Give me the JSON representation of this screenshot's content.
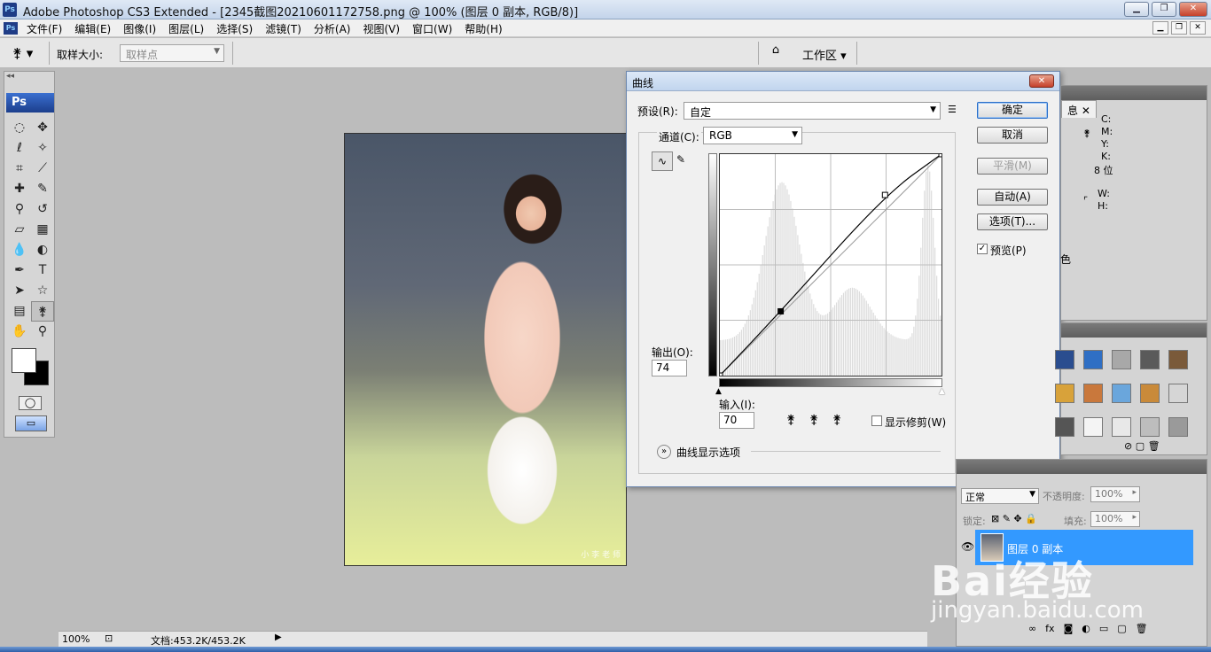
{
  "window": {
    "title": "Adobe Photoshop CS3 Extended - [2345截图20210601172758.png @ 100% (图层 0 副本, RGB/8)]",
    "app_icon_label": "Ps",
    "buttons": [
      "▁",
      "❐",
      "✕"
    ]
  },
  "menubar": {
    "items": [
      "文件(F)",
      "编辑(E)",
      "图像(I)",
      "图层(L)",
      "选择(S)",
      "滤镜(T)",
      "分析(A)",
      "视图(V)",
      "窗口(W)",
      "帮助(H)"
    ],
    "doc_buttons": [
      "▁",
      "❐",
      "✕"
    ]
  },
  "options": {
    "tool_icon": "eyedropper-icon",
    "sample_size_label": "取样大小:",
    "sample_size_value": "取样点",
    "workspace_label": "工作区 ▾"
  },
  "toolbox": {
    "logo": "Ps",
    "tools": [
      {
        "name": "marquee-icon",
        "glyph": "◌"
      },
      {
        "name": "move-icon",
        "glyph": "✥"
      },
      {
        "name": "lasso-icon",
        "glyph": "ℓ"
      },
      {
        "name": "magic-wand-icon",
        "glyph": "✧"
      },
      {
        "name": "crop-icon",
        "glyph": "⌗"
      },
      {
        "name": "slice-icon",
        "glyph": "⟋"
      },
      {
        "name": "healing-brush-icon",
        "glyph": "✚"
      },
      {
        "name": "brush-icon",
        "glyph": "✎"
      },
      {
        "name": "clone-stamp-icon",
        "glyph": "⚲"
      },
      {
        "name": "history-brush-icon",
        "glyph": "↺"
      },
      {
        "name": "eraser-icon",
        "glyph": "▱"
      },
      {
        "name": "gradient-icon",
        "glyph": "▦"
      },
      {
        "name": "blur-icon",
        "glyph": "💧"
      },
      {
        "name": "dodge-icon",
        "glyph": "◐"
      },
      {
        "name": "pen-icon",
        "glyph": "✒"
      },
      {
        "name": "type-icon",
        "glyph": "T"
      },
      {
        "name": "path-selection-icon",
        "glyph": "➤"
      },
      {
        "name": "shape-icon",
        "glyph": "☆"
      },
      {
        "name": "notes-icon",
        "glyph": "▤"
      },
      {
        "name": "eyedropper-tool-icon",
        "glyph": "⚵"
      },
      {
        "name": "hand-icon",
        "glyph": "✋"
      },
      {
        "name": "zoom-icon",
        "glyph": "⚲"
      }
    ],
    "active_tool": "eyedropper-tool-icon"
  },
  "canvas": {
    "watermark": "小 李 老 师"
  },
  "status": {
    "zoom": "100%",
    "doc_size": "文档:453.2K/453.2K"
  },
  "curves": {
    "title": "曲线",
    "preset_label": "预设(R):",
    "preset_value": "自定",
    "channel_label": "通道(C):",
    "channel_value": "RGB",
    "output_label": "输出(O):",
    "output_value": "74",
    "input_label": "输入(I):",
    "input_value": "70",
    "show_clipping_label": "显示修剪(W)",
    "display_options_label": "曲线显示选项",
    "buttons": {
      "ok": "确定",
      "cancel": "取消",
      "smooth": "平滑(M)",
      "auto": "自动(A)",
      "options": "选项(T)..."
    },
    "preview_label": "预览(P)",
    "preview_checked": true,
    "curve_points": [
      [
        0,
        0
      ],
      [
        70,
        74
      ],
      [
        190,
        208
      ],
      [
        255,
        255
      ]
    ]
  },
  "info_panel": {
    "tab_label": "息",
    "cmyk_labels": [
      "C:",
      "M:",
      "Y:",
      "K:"
    ],
    "bit_depth": "8 位",
    "w_label": "W:",
    "h_label": "H:",
    "color_text": "色"
  },
  "swatches": {
    "colors": [
      "#2a4d8f",
      "#2f6fc4",
      "#a8a8a8",
      "#5a5a5a",
      "#7a5a3a",
      "#d8a23a",
      "#c9783c",
      "#6aa6dc",
      "#c98a3a",
      "#d6d6d6",
      "#555555",
      "#f4f4f4",
      "#e8e8e8",
      "#bdbdbd",
      "#9a9a9a"
    ]
  },
  "layers": {
    "blend_mode": "正常",
    "opacity_label": "不透明度:",
    "opacity_value": "100%",
    "lock_label": "锁定:",
    "fill_label": "填充:",
    "fill_value": "100%",
    "layer_name": "图层 0 副本",
    "bottom_icons": [
      "∞",
      "fx",
      "◙",
      "◐",
      "▭",
      "▢",
      "🗑"
    ]
  },
  "watermark_overlay": {
    "brand": "Bai经验",
    "url": "jingyan.baidu.com"
  }
}
